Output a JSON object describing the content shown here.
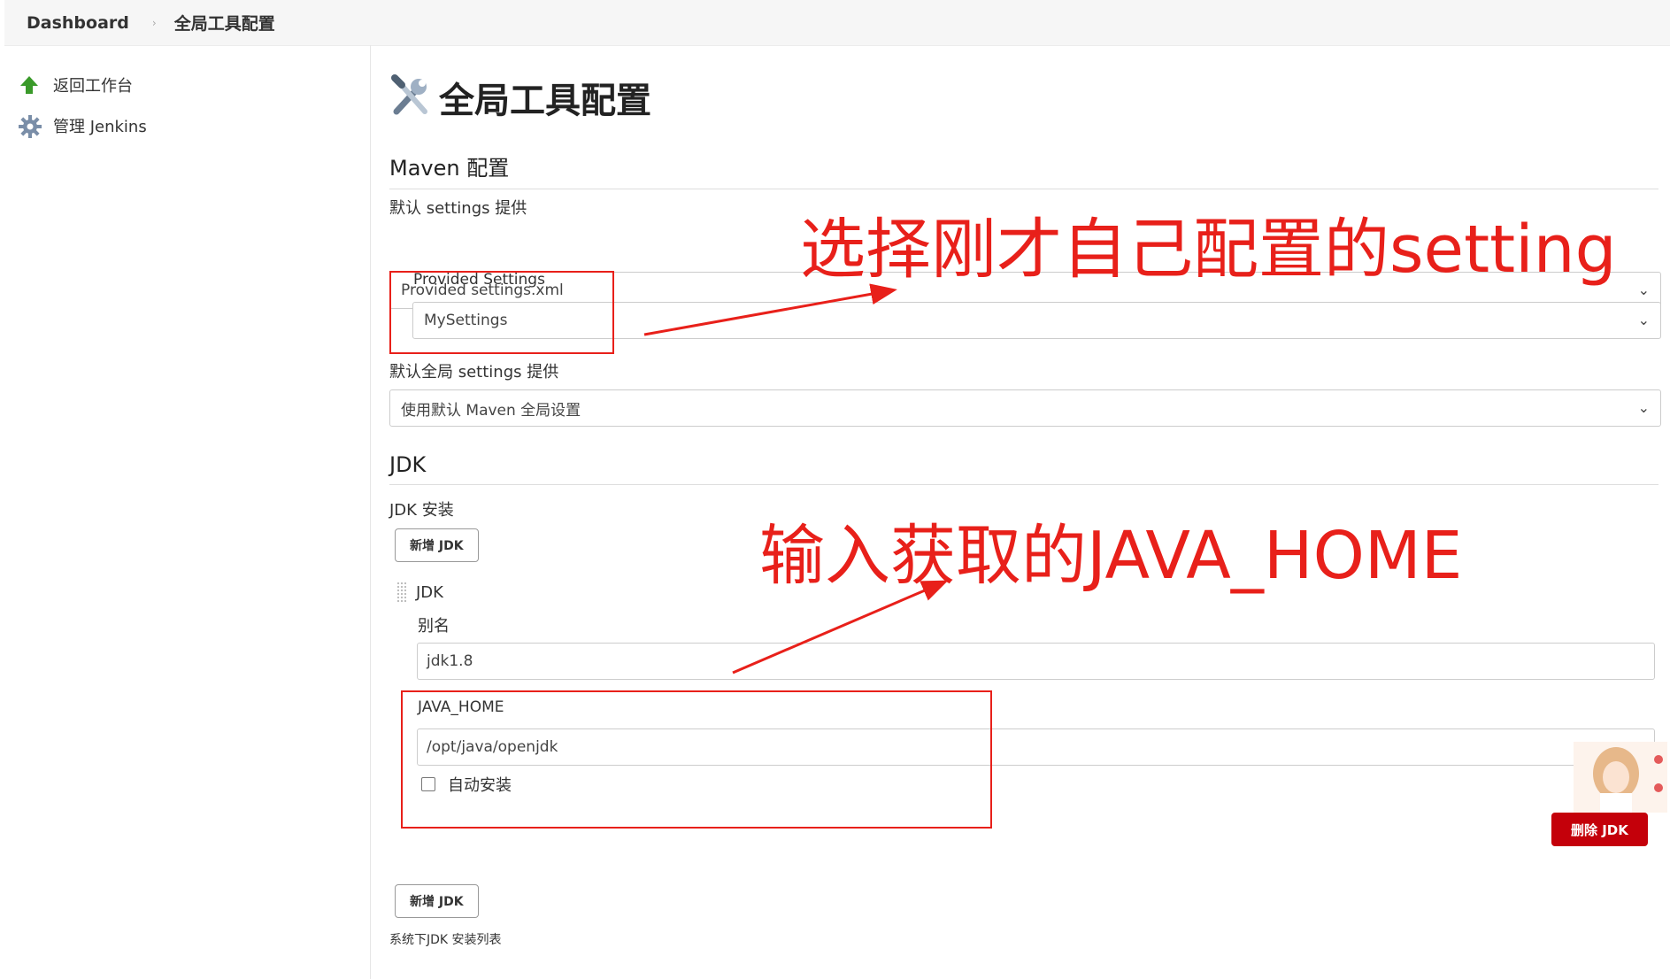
{
  "breadcrumb": {
    "items": [
      "Dashboard",
      "全局工具配置"
    ]
  },
  "sidebar": {
    "items": [
      {
        "label": "返回工作台",
        "icon": "up-arrow-icon"
      },
      {
        "label": "管理 Jenkins",
        "icon": "gear-icon"
      }
    ]
  },
  "page": {
    "title": "全局工具配置",
    "icon": "tools-icon"
  },
  "maven": {
    "section_title": "Maven 配置",
    "default_settings_label": "默认 settings 提供",
    "default_settings_value": "Provided settings.xml",
    "provided_settings_label": "Provided Settings",
    "provided_settings_value": "MySettings",
    "global_settings_label": "默认全局 settings 提供",
    "global_settings_value": "使用默认 Maven 全局设置"
  },
  "jdk": {
    "section_title": "JDK",
    "install_label": "JDK 安装",
    "add_button": "新增 JDK",
    "item_header": "JDK",
    "alias_label": "别名",
    "alias_value": "jdk1.8",
    "java_home_label": "JAVA_HOME",
    "java_home_value": "/opt/java/openjdk",
    "auto_install_label": "自动安装",
    "auto_install_checked": false,
    "delete_button": "删除 JDK",
    "add_button_bottom": "新增 JDK",
    "system_list_note": "系统下JDK 安装列表"
  },
  "annotations": {
    "settings_note": "选择刚才自己配置的setting",
    "java_home_note": "输入获取的JAVA_HOME"
  },
  "colors": {
    "annotation_red": "#e8201a",
    "danger_button": "#c4000a",
    "topbar_bg": "#f6f6f6",
    "arrow_green": "#3a9a2a"
  }
}
